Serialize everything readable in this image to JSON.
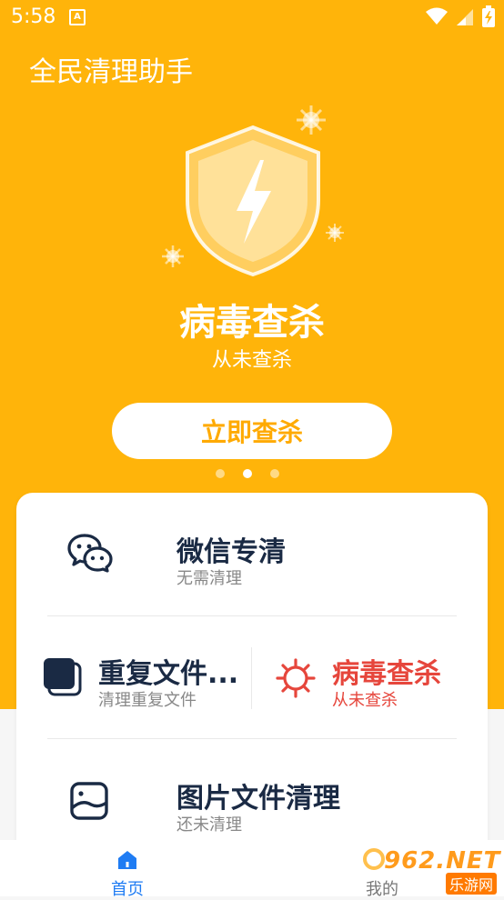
{
  "status": {
    "time": "5:58",
    "a_icon": "A"
  },
  "app": {
    "title": "全民清理助手"
  },
  "hero": {
    "title": "病毒查杀",
    "subtitle": "从未查杀",
    "button_label": "立即查杀",
    "page_indicator": {
      "count": 3,
      "active": 2
    }
  },
  "features": {
    "wechat": {
      "title": "微信专清",
      "subtitle": "无需清理",
      "icon": "wechat-icon"
    },
    "duplicate": {
      "title": "重复文件...",
      "subtitle": "清理重复文件",
      "icon": "duplicate-files-icon"
    },
    "virus": {
      "title": "病毒查杀",
      "subtitle": "从未查杀",
      "icon": "virus-icon"
    },
    "images": {
      "title": "图片文件清理",
      "subtitle": "还未清理",
      "icon": "image-icon"
    }
  },
  "nav": {
    "home_label": "首页",
    "me_label": "我的"
  },
  "watermark": {
    "text": "962.NET",
    "sub": "乐游网"
  },
  "colors": {
    "primary": "#ffb40a",
    "accent_blue": "#1f7cf3",
    "danger": "#e6463c",
    "dark_text": "#1a2a44"
  }
}
